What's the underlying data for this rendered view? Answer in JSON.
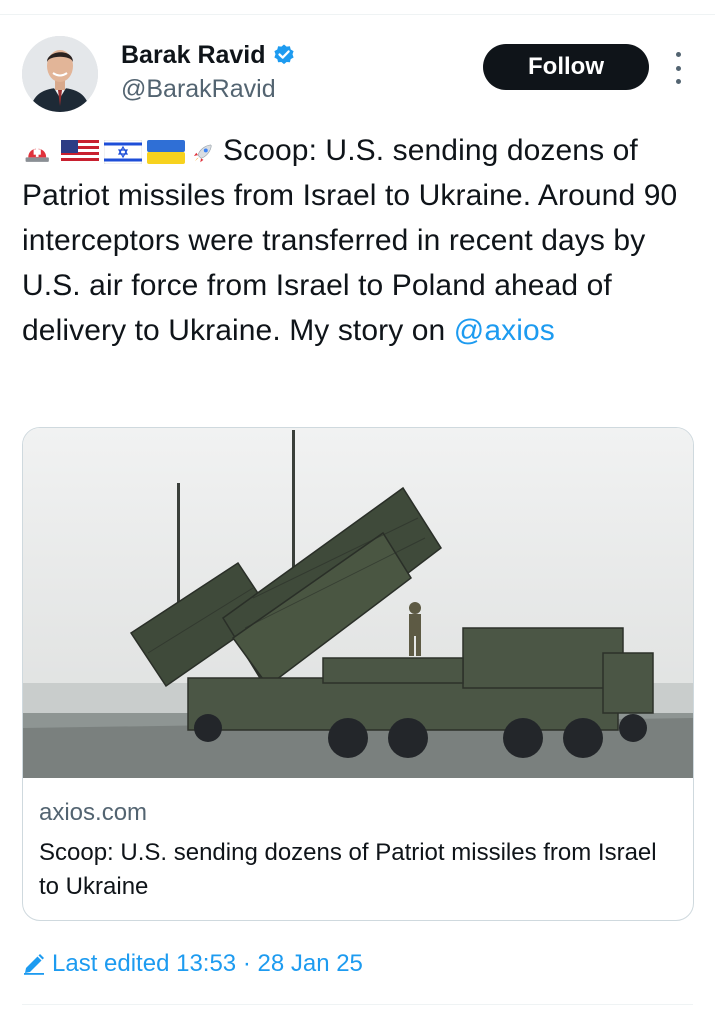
{
  "author": {
    "display_name": "Barak Ravid",
    "handle": "@BarakRavid",
    "verified": true
  },
  "follow_label": "Follow",
  "tweet": {
    "emojis": [
      "police-light-emoji",
      "us-flag-emoji",
      "israel-flag-emoji",
      "ukraine-flag-emoji",
      "rocket-emoji"
    ],
    "text": "Scoop: U.S. sending dozens of Patriot missiles from Israel to Ukraine. Around 90 interceptors were transferred in recent days by U.S. air force from Israel to Poland ahead of delivery to Ukraine. My story on ",
    "mention": "@axios"
  },
  "card": {
    "image_icon": "patriot-missile-launcher-photo",
    "domain": "axios.com",
    "title": "Scoop: U.S. sending dozens of Patriot missiles from Israel to Ukraine"
  },
  "footer": {
    "edited_label": "Last edited 13:53 · 28 Jan 25"
  },
  "colors": {
    "accent": "#1d9bf0",
    "text": "#0f1419",
    "secondary": "#536471",
    "follow_bg": "#0f1419"
  }
}
